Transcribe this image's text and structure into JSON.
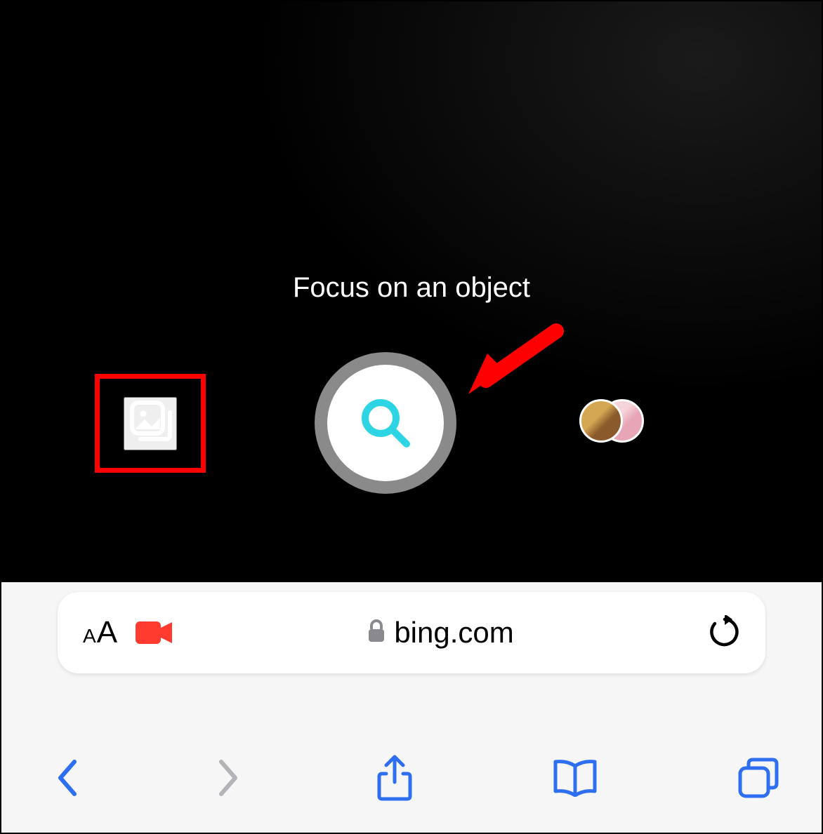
{
  "camera": {
    "hint_text": "Focus on an object",
    "icons": {
      "gallery": "gallery-icon",
      "search": "search-icon",
      "recent": "recent-thumbnails"
    }
  },
  "annotations": {
    "highlight_color": "#ff0000",
    "arrow_color": "#ff0000"
  },
  "browser": {
    "url_display": "bing.com",
    "controls": {
      "text_size_label": "aA",
      "recording_color": "#ff3b30"
    }
  },
  "colors": {
    "accent_blue": "#2e6ff2",
    "search_cyan": "#2dd5e4",
    "inactive_gray": "#b4b4b8"
  }
}
